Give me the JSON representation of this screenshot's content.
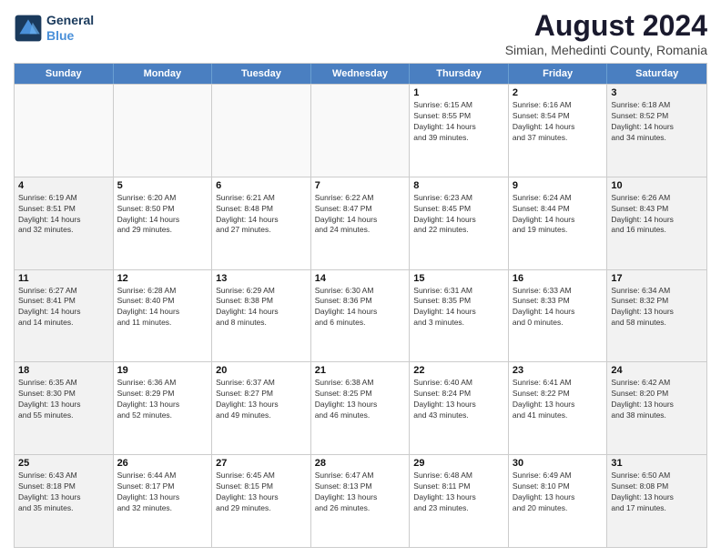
{
  "header": {
    "logo_line1": "General",
    "logo_line2": "Blue",
    "title": "August 2024",
    "subtitle": "Simian, Mehedinti County, Romania"
  },
  "weekdays": [
    "Sunday",
    "Monday",
    "Tuesday",
    "Wednesday",
    "Thursday",
    "Friday",
    "Saturday"
  ],
  "rows": [
    [
      {
        "day": "",
        "info": ""
      },
      {
        "day": "",
        "info": ""
      },
      {
        "day": "",
        "info": ""
      },
      {
        "day": "",
        "info": ""
      },
      {
        "day": "1",
        "info": "Sunrise: 6:15 AM\nSunset: 8:55 PM\nDaylight: 14 hours\nand 39 minutes."
      },
      {
        "day": "2",
        "info": "Sunrise: 6:16 AM\nSunset: 8:54 PM\nDaylight: 14 hours\nand 37 minutes."
      },
      {
        "day": "3",
        "info": "Sunrise: 6:18 AM\nSunset: 8:52 PM\nDaylight: 14 hours\nand 34 minutes."
      }
    ],
    [
      {
        "day": "4",
        "info": "Sunrise: 6:19 AM\nSunset: 8:51 PM\nDaylight: 14 hours\nand 32 minutes."
      },
      {
        "day": "5",
        "info": "Sunrise: 6:20 AM\nSunset: 8:50 PM\nDaylight: 14 hours\nand 29 minutes."
      },
      {
        "day": "6",
        "info": "Sunrise: 6:21 AM\nSunset: 8:48 PM\nDaylight: 14 hours\nand 27 minutes."
      },
      {
        "day": "7",
        "info": "Sunrise: 6:22 AM\nSunset: 8:47 PM\nDaylight: 14 hours\nand 24 minutes."
      },
      {
        "day": "8",
        "info": "Sunrise: 6:23 AM\nSunset: 8:45 PM\nDaylight: 14 hours\nand 22 minutes."
      },
      {
        "day": "9",
        "info": "Sunrise: 6:24 AM\nSunset: 8:44 PM\nDaylight: 14 hours\nand 19 minutes."
      },
      {
        "day": "10",
        "info": "Sunrise: 6:26 AM\nSunset: 8:43 PM\nDaylight: 14 hours\nand 16 minutes."
      }
    ],
    [
      {
        "day": "11",
        "info": "Sunrise: 6:27 AM\nSunset: 8:41 PM\nDaylight: 14 hours\nand 14 minutes."
      },
      {
        "day": "12",
        "info": "Sunrise: 6:28 AM\nSunset: 8:40 PM\nDaylight: 14 hours\nand 11 minutes."
      },
      {
        "day": "13",
        "info": "Sunrise: 6:29 AM\nSunset: 8:38 PM\nDaylight: 14 hours\nand 8 minutes."
      },
      {
        "day": "14",
        "info": "Sunrise: 6:30 AM\nSunset: 8:36 PM\nDaylight: 14 hours\nand 6 minutes."
      },
      {
        "day": "15",
        "info": "Sunrise: 6:31 AM\nSunset: 8:35 PM\nDaylight: 14 hours\nand 3 minutes."
      },
      {
        "day": "16",
        "info": "Sunrise: 6:33 AM\nSunset: 8:33 PM\nDaylight: 14 hours\nand 0 minutes."
      },
      {
        "day": "17",
        "info": "Sunrise: 6:34 AM\nSunset: 8:32 PM\nDaylight: 13 hours\nand 58 minutes."
      }
    ],
    [
      {
        "day": "18",
        "info": "Sunrise: 6:35 AM\nSunset: 8:30 PM\nDaylight: 13 hours\nand 55 minutes."
      },
      {
        "day": "19",
        "info": "Sunrise: 6:36 AM\nSunset: 8:29 PM\nDaylight: 13 hours\nand 52 minutes."
      },
      {
        "day": "20",
        "info": "Sunrise: 6:37 AM\nSunset: 8:27 PM\nDaylight: 13 hours\nand 49 minutes."
      },
      {
        "day": "21",
        "info": "Sunrise: 6:38 AM\nSunset: 8:25 PM\nDaylight: 13 hours\nand 46 minutes."
      },
      {
        "day": "22",
        "info": "Sunrise: 6:40 AM\nSunset: 8:24 PM\nDaylight: 13 hours\nand 43 minutes."
      },
      {
        "day": "23",
        "info": "Sunrise: 6:41 AM\nSunset: 8:22 PM\nDaylight: 13 hours\nand 41 minutes."
      },
      {
        "day": "24",
        "info": "Sunrise: 6:42 AM\nSunset: 8:20 PM\nDaylight: 13 hours\nand 38 minutes."
      }
    ],
    [
      {
        "day": "25",
        "info": "Sunrise: 6:43 AM\nSunset: 8:18 PM\nDaylight: 13 hours\nand 35 minutes."
      },
      {
        "day": "26",
        "info": "Sunrise: 6:44 AM\nSunset: 8:17 PM\nDaylight: 13 hours\nand 32 minutes."
      },
      {
        "day": "27",
        "info": "Sunrise: 6:45 AM\nSunset: 8:15 PM\nDaylight: 13 hours\nand 29 minutes."
      },
      {
        "day": "28",
        "info": "Sunrise: 6:47 AM\nSunset: 8:13 PM\nDaylight: 13 hours\nand 26 minutes."
      },
      {
        "day": "29",
        "info": "Sunrise: 6:48 AM\nSunset: 8:11 PM\nDaylight: 13 hours\nand 23 minutes."
      },
      {
        "day": "30",
        "info": "Sunrise: 6:49 AM\nSunset: 8:10 PM\nDaylight: 13 hours\nand 20 minutes."
      },
      {
        "day": "31",
        "info": "Sunrise: 6:50 AM\nSunset: 8:08 PM\nDaylight: 13 hours\nand 17 minutes."
      }
    ]
  ]
}
